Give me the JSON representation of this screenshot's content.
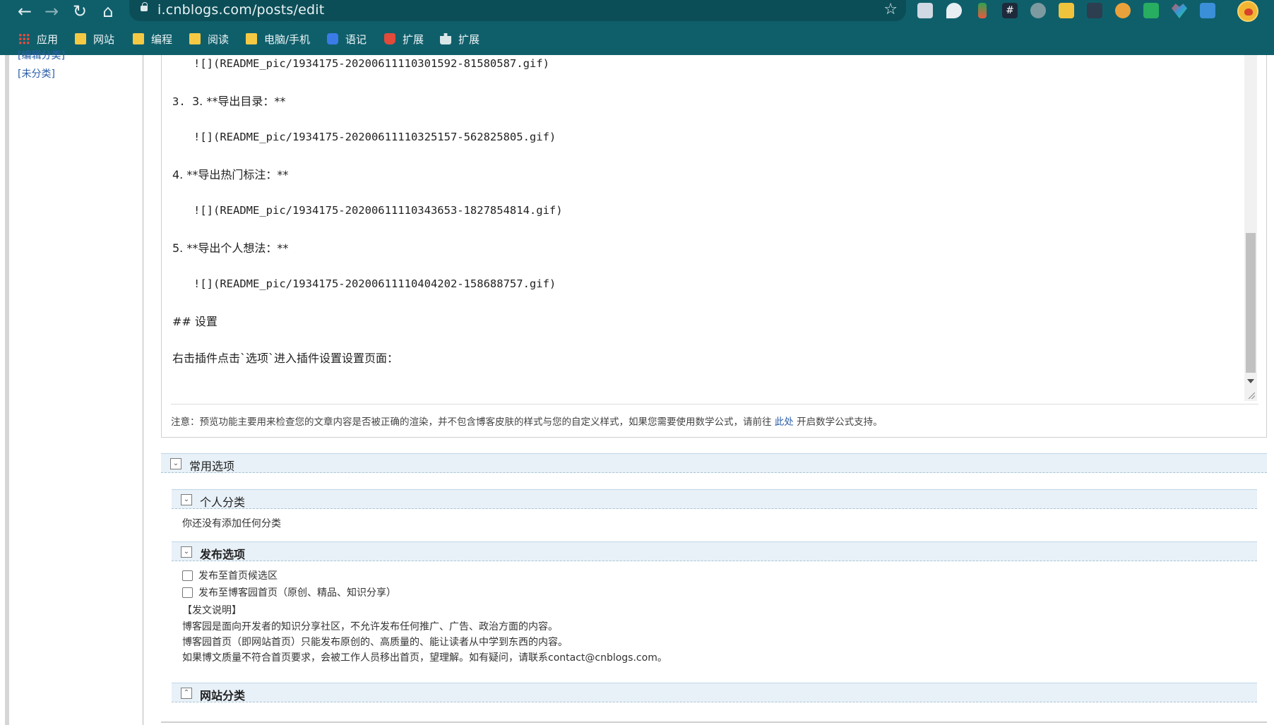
{
  "browser": {
    "url": "i.cnblogs.com/posts/edit",
    "bookmarks": [
      {
        "label": "应用",
        "icon": "apps-grid-icon"
      },
      {
        "label": "网站",
        "icon": "folder-icon"
      },
      {
        "label": "编程",
        "icon": "folder-icon"
      },
      {
        "label": "阅读",
        "icon": "folder-icon"
      },
      {
        "label": "电脑/手机",
        "icon": "folder-icon"
      },
      {
        "label": "语记",
        "icon": "note-extension-icon"
      },
      {
        "label": "扩展",
        "icon": "extension-icon"
      },
      {
        "label": "扩展",
        "icon": "puzzle-icon"
      }
    ]
  },
  "sidebar": {
    "links": [
      "[编辑分类]",
      "[未分类]"
    ]
  },
  "editor": {
    "lines": [
      "![](README_pic/1934175-20200611110301592-81580587.gif)",
      "3. **导出目录：**",
      "![](README_pic/1934175-20200611110325157-562825805.gif)",
      "4. **导出热门标注：**",
      "![](README_pic/1934175-20200611110343653-1827854814.gif)",
      "5. **导出个人想法：**",
      "![](README_pic/1934175-20200611110404202-158688757.gif)",
      "## 设置",
      "右击插件点击`选项`进入插件设置设置页面："
    ],
    "note_prefix": "注意：预览功能主要用来检查您的文章内容是否被正确的渲染，并不包含博客皮肤的样式与您的自定义样式，如果您需要使用数学公式，请前往",
    "note_link": "此处",
    "note_suffix": "开启数学公式支持。"
  },
  "sections": {
    "common_options": "常用选项",
    "personal_category": "个人分类",
    "personal_category_empty": "你还没有添加任何分类",
    "publish_options": "发布选项",
    "publish_candidate": "发布至首页候选区",
    "publish_homepage": "发布至博客园首页（原创、精品、知识分享）",
    "publish_notes": [
      "【发文说明】",
      "博客园是面向开发者的知识分享社区，不允许发布任何推广、广告、政治方面的内容。",
      "博客园首页（即网站首页）只能发布原创的、高质量的、能让读者从中学到东西的内容。",
      "如果博文质量不符合首页要求，会被工作人员移出首页，望理解。如有疑问，请联系contact@cnblogs.com。"
    ],
    "site_category": "网站分类"
  },
  "colors": {
    "chrome": "#0f5f6b",
    "section_bar": "#e8f1f8",
    "link": "#2a5ea7"
  }
}
